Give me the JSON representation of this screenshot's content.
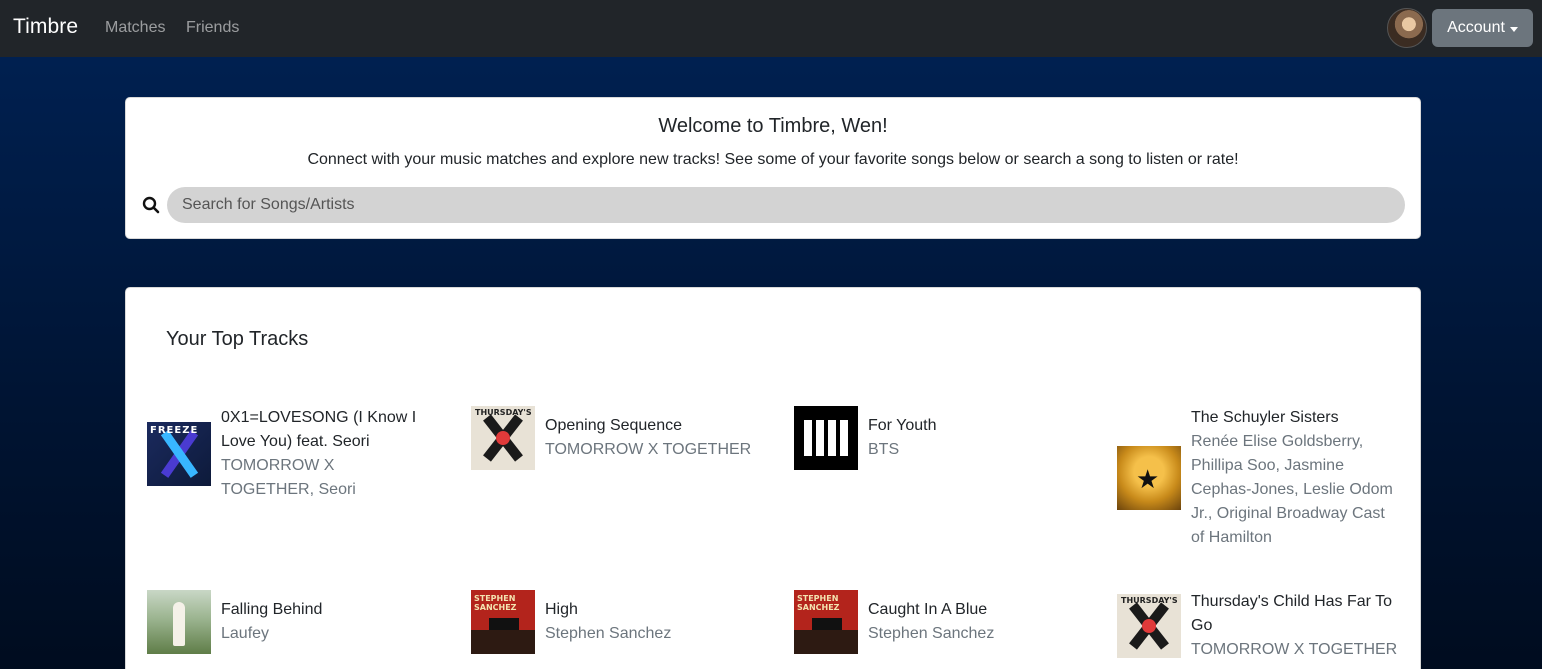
{
  "navbar": {
    "brand": "Timbre",
    "links": [
      "Matches",
      "Friends"
    ],
    "account_label": "Account"
  },
  "welcome": {
    "title": "Welcome to Timbre, Wen!",
    "subtitle": "Connect with your music matches and explore new tracks! See some of your favorite songs below or search a song to listen or rate!",
    "search_placeholder": "Search for Songs/Artists",
    "search_value": ""
  },
  "top_tracks": {
    "title": "Your Top Tracks",
    "tracks": [
      {
        "name": "0X1=LOVESONG (I Know I Love You) feat. Seori",
        "artist": "TOMORROW X TOGETHER, Seori",
        "cover": "freeze-album-cover",
        "cover_text": "FREEZE"
      },
      {
        "name": "Opening Sequence",
        "artist": "TOMORROW X TOGETHER",
        "cover": "thursdays-child-album-cover",
        "cover_text": "THURSDAY'S"
      },
      {
        "name": "For Youth",
        "artist": "BTS",
        "cover": "proof-album-cover"
      },
      {
        "name": "The Schuyler Sisters",
        "artist": "Renée Elise Goldsberry, Phillipa Soo, Jasmine Cephas-Jones, Leslie Odom Jr., Original Broadway Cast of Hamilton",
        "cover": "hamilton-album-cover"
      },
      {
        "name": "Falling Behind",
        "artist": "Laufey",
        "cover": "laufey-album-cover"
      },
      {
        "name": "High",
        "artist": "Stephen Sanchez",
        "cover": "stephen-sanchez-album-cover",
        "cover_text": "STEPHEN SANCHEZ"
      },
      {
        "name": "Caught In A Blue",
        "artist": "Stephen Sanchez",
        "cover": "stephen-sanchez-album-cover",
        "cover_text": "STEPHEN SANCHEZ"
      },
      {
        "name": "Thursday's Child Has Far To Go",
        "artist": "TOMORROW X TOGETHER",
        "cover": "thursdays-child-album-cover",
        "cover_text": "THURSDAY'S"
      }
    ]
  }
}
